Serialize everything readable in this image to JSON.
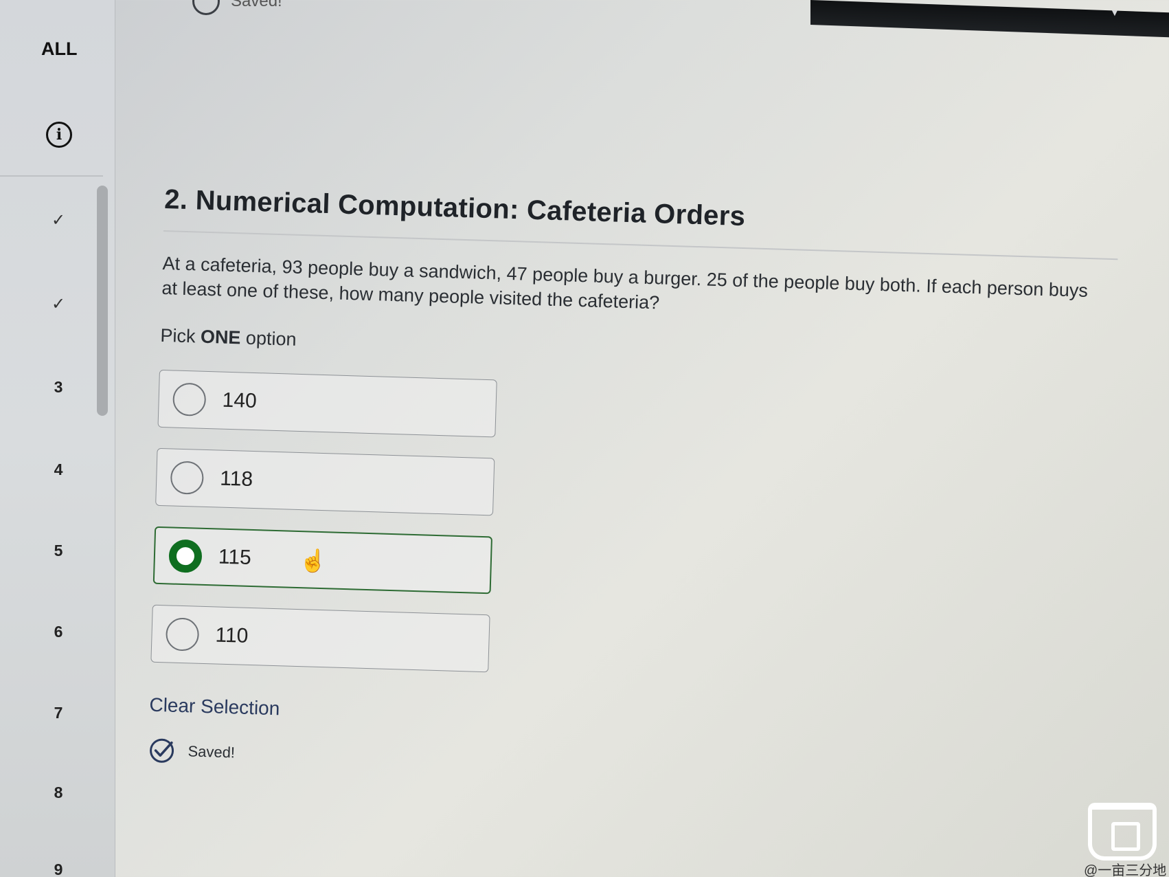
{
  "top_bar": {
    "arrow": "▼",
    "saved_label": "Saved!"
  },
  "sidebar": {
    "all_label": "ALL",
    "info_symbol": "i",
    "items": [
      {
        "label": "✓",
        "state": "answered"
      },
      {
        "label": "✓",
        "state": "answered"
      },
      {
        "label": "3"
      },
      {
        "label": "4"
      },
      {
        "label": "5"
      },
      {
        "label": "6"
      },
      {
        "label": "7"
      },
      {
        "label": "8"
      },
      {
        "label": "9"
      }
    ]
  },
  "question": {
    "title": "2. Numerical Computation: Cafeteria Orders",
    "text": "At a cafeteria, 93 people buy a sandwich, 47 people buy a burger.  25 of the people buy both. If each person buys at least one of these, how many people visited the cafeteria?",
    "instruction_prefix": "Pick ",
    "instruction_bold": "ONE",
    "instruction_suffix": " option",
    "options": [
      {
        "label": "140",
        "selected": false
      },
      {
        "label": "118",
        "selected": false
      },
      {
        "label": "115",
        "selected": true
      },
      {
        "label": "110",
        "selected": false
      }
    ],
    "clear_label": "Clear Selection",
    "saved_label": "Saved!"
  },
  "watermark": {
    "text": "@一亩三分地"
  },
  "colors": {
    "selected_radio": "#0f6e20",
    "link": "#2a3a5e"
  }
}
